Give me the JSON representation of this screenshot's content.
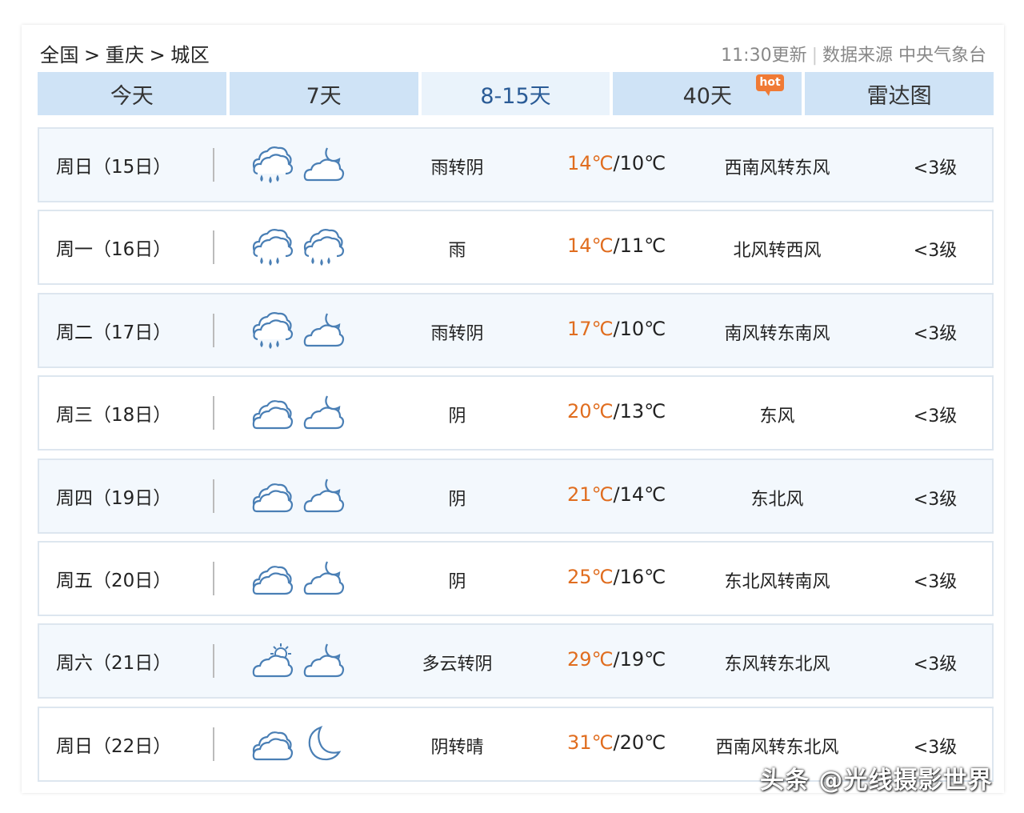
{
  "breadcrumb": {
    "country": "全国",
    "city": "重庆",
    "district": "城区",
    "separator": ">"
  },
  "update_info": {
    "time": "11:30更新",
    "source": "数据来源 中央气象台"
  },
  "tabs": [
    {
      "label": "今天",
      "active": false
    },
    {
      "label": "7天",
      "active": false
    },
    {
      "label": "8-15天",
      "active": true
    },
    {
      "label": "40天",
      "active": false,
      "badge": "hot"
    },
    {
      "label": "雷达图",
      "active": false
    }
  ],
  "forecast": [
    {
      "day": "周日（15日）",
      "icons": [
        "rain-cloud-icon",
        "cloudy-night-icon"
      ],
      "weather": "雨转阴",
      "high": "14℃",
      "low": "10℃",
      "wind": "西南风转东风",
      "level": "<3级"
    },
    {
      "day": "周一（16日）",
      "icons": [
        "rain-cloud-icon",
        "rain-cloud-icon"
      ],
      "weather": "雨",
      "high": "14℃",
      "low": "11℃",
      "wind": "北风转西风",
      "level": "<3级"
    },
    {
      "day": "周二（17日）",
      "icons": [
        "rain-cloud-icon",
        "cloudy-night-icon"
      ],
      "weather": "雨转阴",
      "high": "17℃",
      "low": "10℃",
      "wind": "南风转东南风",
      "level": "<3级"
    },
    {
      "day": "周三（18日）",
      "icons": [
        "overcast-icon",
        "cloudy-night-icon"
      ],
      "weather": "阴",
      "high": "20℃",
      "low": "13℃",
      "wind": "东风",
      "level": "<3级"
    },
    {
      "day": "周四（19日）",
      "icons": [
        "overcast-icon",
        "cloudy-night-icon"
      ],
      "weather": "阴",
      "high": "21℃",
      "low": "14℃",
      "wind": "东北风",
      "level": "<3级"
    },
    {
      "day": "周五（20日）",
      "icons": [
        "overcast-icon",
        "cloudy-night-icon"
      ],
      "weather": "阴",
      "high": "25℃",
      "low": "16℃",
      "wind": "东北风转南风",
      "level": "<3级"
    },
    {
      "day": "周六（21日）",
      "icons": [
        "partly-cloudy-day-icon",
        "cloudy-night-icon"
      ],
      "weather": "多云转阴",
      "high": "29℃",
      "low": "19℃",
      "wind": "东风转东北风",
      "level": "<3级"
    },
    {
      "day": "周日（22日）",
      "icons": [
        "overcast-icon",
        "clear-night-moon-icon"
      ],
      "weather": "阴转晴",
      "high": "31℃",
      "low": "20℃",
      "wind": "西南风转东北风",
      "level": "<3级"
    }
  ],
  "watermark": "头条 @光线摄影世界",
  "colors": {
    "tab_bg": "#cfe3f6",
    "tab_active_bg": "#eaf3fb",
    "tab_active_text": "#2a5b96",
    "temp_high": "#e06d1f",
    "hot_badge": "#f07a35",
    "icon_stroke": "#4a7fb5"
  }
}
